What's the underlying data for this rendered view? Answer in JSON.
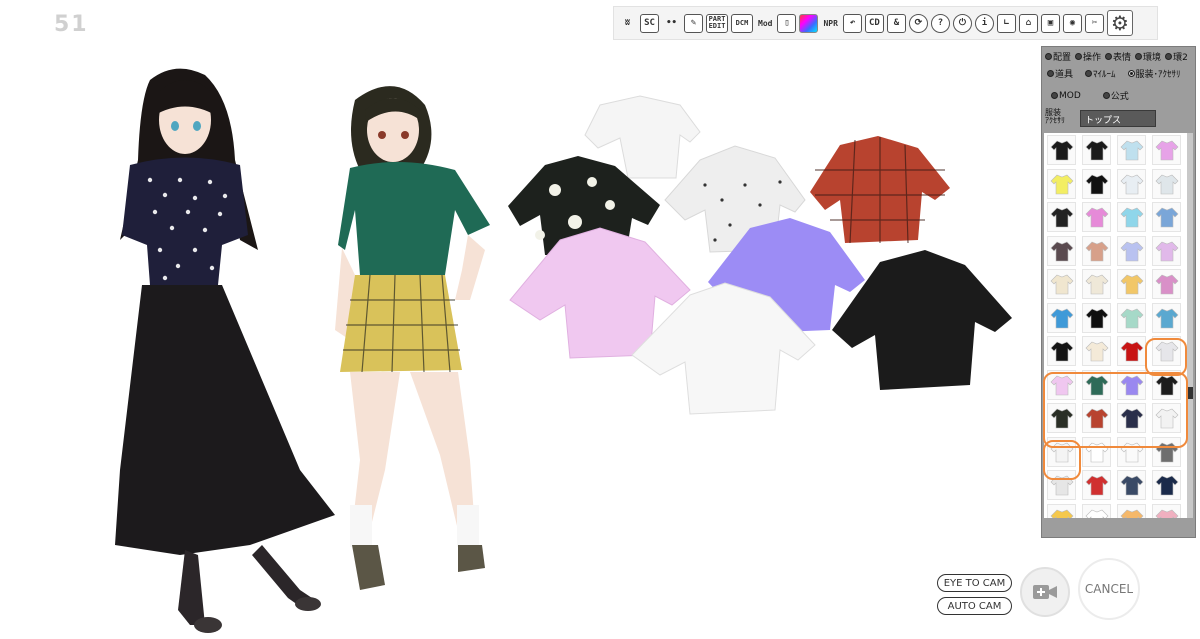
{
  "hud": {
    "fps": "51"
  },
  "toolbar": {
    "buttons": [
      {
        "name": "timeline-icon",
        "glyph": "ʬ"
      },
      {
        "name": "sc-button",
        "glyph": "SC"
      },
      {
        "name": "eyes-icon",
        "glyph": "••"
      },
      {
        "name": "pen-icon",
        "glyph": "✎"
      },
      {
        "name": "part-edit-button",
        "glyph": "PART EDIT"
      },
      {
        "name": "dcm-button",
        "glyph": "DCM"
      },
      {
        "name": "mod-button",
        "glyph": "Mod"
      },
      {
        "name": "info-tall-icon",
        "glyph": "▯"
      },
      {
        "name": "color-picker-icon",
        "glyph": ""
      },
      {
        "name": "npr-button",
        "glyph": "NPR"
      },
      {
        "name": "undo-icon",
        "glyph": "↶"
      },
      {
        "name": "cd-button",
        "glyph": "CD"
      },
      {
        "name": "link-icon",
        "glyph": "&"
      },
      {
        "name": "refresh-icon",
        "glyph": "⟳"
      },
      {
        "name": "help-icon",
        "glyph": "?"
      },
      {
        "name": "power-icon",
        "glyph": "⏻"
      },
      {
        "name": "info-icon",
        "glyph": "i"
      },
      {
        "name": "ruler-icon",
        "glyph": "∟"
      },
      {
        "name": "basket-icon",
        "glyph": "⌂"
      },
      {
        "name": "save-icon",
        "glyph": "▣"
      },
      {
        "name": "camera-icon",
        "glyph": "◉"
      },
      {
        "name": "tools-icon",
        "glyph": "✂"
      }
    ],
    "settings_glyph": "⚙"
  },
  "panel": {
    "tabs_row1": [
      "配置",
      "操作",
      "表情",
      "環境",
      "環2"
    ],
    "tabs_row2": [
      "道具",
      "ﾏｲﾙｰﾑ",
      "服装･ｱｸｾｻﾘ"
    ],
    "tabs_row3": [
      "MOD",
      "公式"
    ],
    "category_label_line1": "服装",
    "category_label_line2": "ｱｸｾｻﾘ",
    "category_value": "トップス",
    "thumb_rows": [
      [
        "#1a1a1a",
        "#1a1a1a",
        "#bfe0ee",
        "#e7a3e8"
      ],
      [
        "#f3ee63",
        "#111111",
        "#e8eef3",
        "#dfe6ea"
      ],
      [
        "#222222",
        "#e68ad8",
        "#8fd6ea",
        "#7aa6d8"
      ],
      [
        "#5a4a4f",
        "#d7a08a",
        "#b9c2f0",
        "#e1b9ea"
      ],
      [
        "#f0e6cf",
        "#efe8d8",
        "#f2c768",
        "#d990c8"
      ],
      [
        "#3f9ad8",
        "#0f0f0f",
        "#a6d9c8",
        "#5aa8d0"
      ],
      [
        "#141414",
        "#f4ead8",
        "#c81414",
        "#e6e6ea"
      ],
      [
        "#f0c7f0",
        "#2e6b58",
        "#9a88f0",
        "#1c1c1c"
      ],
      [
        "#2a2f26",
        "#b8432f",
        "#2a2f4a",
        "#f2f2f2"
      ],
      [
        "#f4f4f4",
        "#ffffff",
        "#fafafa",
        "#6e6e6e"
      ],
      [
        "#e6e6e6",
        "#d03030",
        "#3a4a66",
        "#1a2a4a"
      ],
      [
        "#f5c84c",
        "#ffffff",
        "#f5b86a",
        "#f0b0c0"
      ]
    ]
  },
  "scene": {
    "characters": [
      {
        "name": "girl-long-hair",
        "blouse_color": "#1f1f3a",
        "skirt_color": "#1c1a1c",
        "hair_color": "#1b1615"
      },
      {
        "name": "girl-short-hair",
        "blouse_color": "#1f6a55",
        "skirt_color": "#d9c25a",
        "hair_color": "#2b2a1f"
      }
    ],
    "shirts": [
      {
        "name": "white-shirt",
        "color": "#f5f5f5"
      },
      {
        "name": "floral-black-shirt",
        "color": "#1d211d"
      },
      {
        "name": "white-dotted-shirt",
        "color": "#eeeeee"
      },
      {
        "name": "red-plaid-shirt",
        "color": "#b8432f"
      },
      {
        "name": "pink-shirt",
        "color": "#f0c8f0"
      },
      {
        "name": "purple-shirt",
        "color": "#9c8cf5"
      },
      {
        "name": "white-shirt-front",
        "color": "#f7f7f7"
      },
      {
        "name": "black-shirt",
        "color": "#1b1b1b"
      }
    ]
  },
  "camera": {
    "eye_to_cam": "EYE TO CAM",
    "auto_cam": "AUTO CAM",
    "cancel": "CANCEL"
  }
}
